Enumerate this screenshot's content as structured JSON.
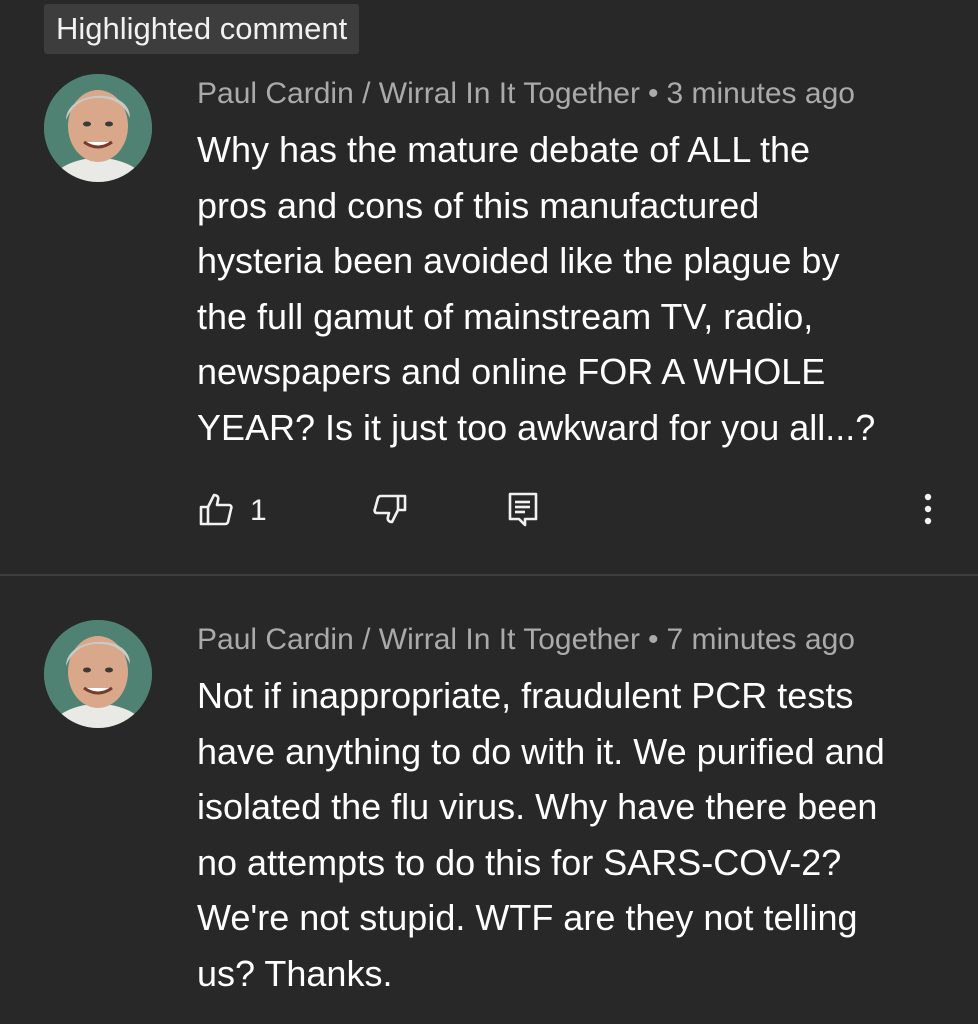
{
  "badge": {
    "label": "Highlighted comment"
  },
  "comments": [
    {
      "author": "Paul Cardin / Wirral In It Together",
      "separator": "•",
      "time": "3 minutes ago",
      "lines": [
        "Why has the mature debate of ALL the",
        "pros and cons of this manufactured",
        "hysteria been avoided like the plague by",
        "the full gamut of mainstream TV, radio,",
        "newspapers and online FOR A WHOLE",
        "YEAR? Is it just too awkward for you all...?"
      ],
      "likes": "1"
    },
    {
      "author": "Paul Cardin / Wirral In It Together",
      "separator": "•",
      "time": "7 minutes ago",
      "lines": [
        "Not if inappropriate, fraudulent PCR tests",
        "have anything to do with it. We purified and",
        "isolated the flu virus. Why have there been",
        "no attempts to do this for SARS-COV-2?",
        "We're not stupid. WTF are they not telling",
        "us? Thanks."
      ]
    }
  ],
  "icons": {
    "like": "thumb-up-icon",
    "dislike": "thumb-down-icon",
    "reply": "comment-reply-icon",
    "more": "more-vertical-icon"
  },
  "colors": {
    "background": "#282828",
    "badge_bg": "#3d3d3d",
    "meta_text": "#aaaaaa",
    "body_text": "#ffffff",
    "divider": "#3e3e3e"
  }
}
